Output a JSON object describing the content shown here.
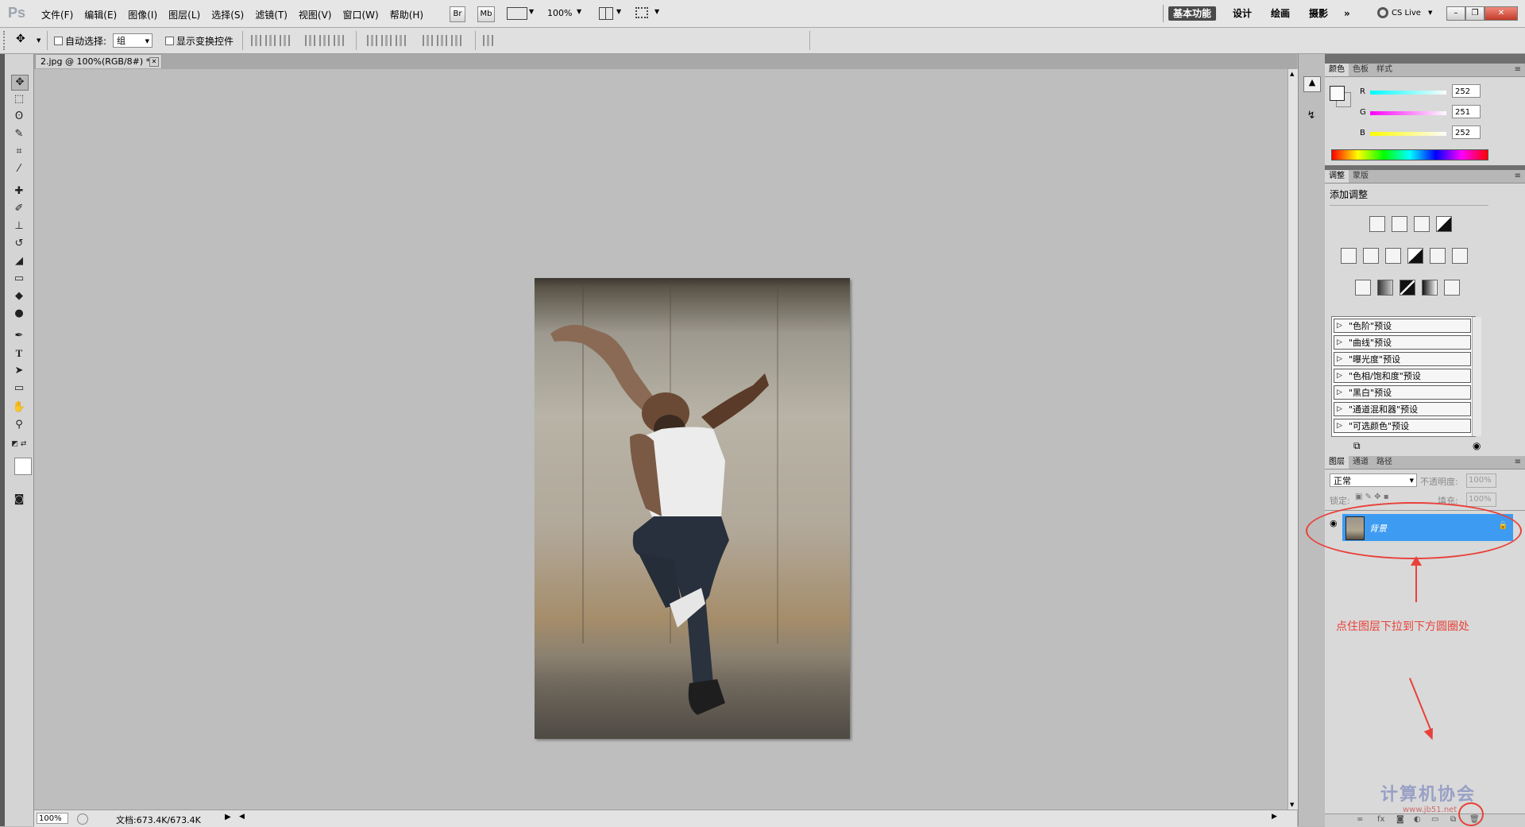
{
  "menubar": {
    "logo": "Ps",
    "items": [
      "文件(F)",
      "编辑(E)",
      "图像(I)",
      "图层(L)",
      "选择(S)",
      "滤镜(T)",
      "视图(V)",
      "窗口(W)",
      "帮助(H)"
    ],
    "bridge": "Br",
    "minibridge": "Mb",
    "zoom": "100%",
    "workspaces": [
      "基本功能",
      "设计",
      "绘画",
      "摄影"
    ],
    "more": "»",
    "cslive": "CS Live"
  },
  "options": {
    "auto_select_label": "自动选择:",
    "auto_select_value": "组",
    "show_transform_label": "显示变换控件"
  },
  "document": {
    "tab_title": "2.jpg @ 100%(RGB/8#) *",
    "zoom": "100%",
    "doc_info": "文档:673.4K/673.4K"
  },
  "color_panel": {
    "tabs": [
      "颜色",
      "色板",
      "样式"
    ],
    "r_label": "R",
    "g_label": "G",
    "b_label": "B",
    "r": "252",
    "g": "251",
    "b": "252"
  },
  "adjust_panel": {
    "tabs": [
      "调整",
      "蒙版"
    ],
    "title": "添加调整",
    "presets": [
      "\"色阶\"预设",
      "\"曲线\"预设",
      "\"曝光度\"预设",
      "\"色相/饱和度\"预设",
      "\"黑白\"预设",
      "\"通道混和器\"预设",
      "\"可选颜色\"预设"
    ]
  },
  "layers_panel": {
    "tabs": [
      "图层",
      "通道",
      "路径"
    ],
    "blend_mode": "正常",
    "opacity_label": "不透明度:",
    "opacity": "100%",
    "lock_label": "锁定:",
    "fill_label": "填充:",
    "fill": "100%",
    "layer_name": "背景"
  },
  "annotation": {
    "text": "点住图层下拉到下方圆圈处",
    "color": "#e8413a"
  },
  "watermark": {
    "text": "计算机协会",
    "url": "www.jb51.net"
  }
}
